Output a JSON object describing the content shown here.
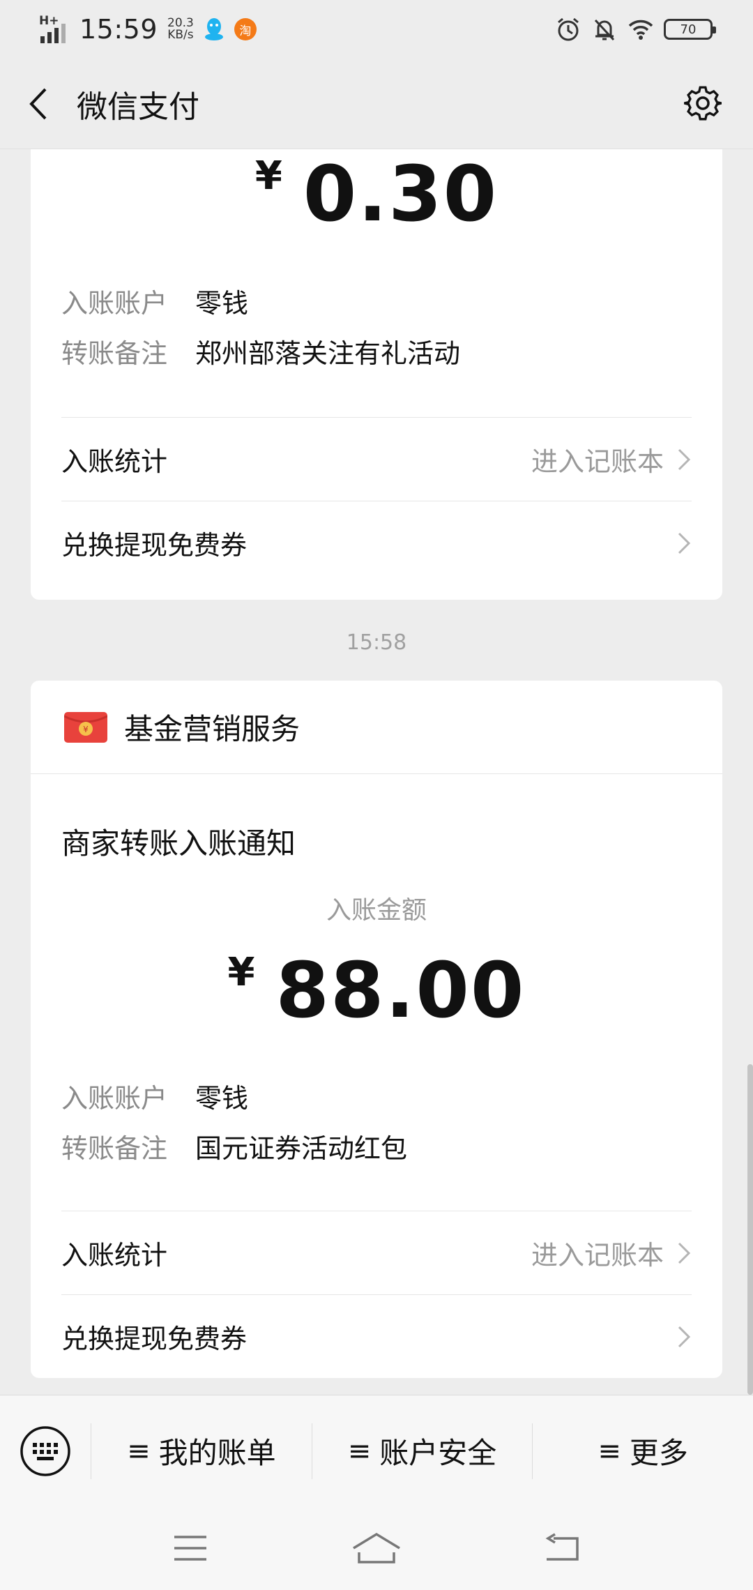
{
  "status_bar": {
    "network": "H+",
    "time": "15:59",
    "speed_value": "20.3",
    "speed_unit": "KB/s",
    "taobao_label": "淘",
    "battery": "70"
  },
  "nav": {
    "title": "微信支付"
  },
  "messages": [
    {
      "amount_currency": "¥",
      "amount_value": "0.30",
      "fields": [
        {
          "label": "入账账户",
          "value": "零钱"
        },
        {
          "label": "转账备注",
          "value": "郑州部落关注有礼活动"
        }
      ],
      "rows": [
        {
          "label": "入账统计",
          "action": "进入记账本"
        },
        {
          "label": "兑换提现免费券",
          "action": ""
        }
      ]
    },
    {
      "timestamp": "15:58",
      "sender": "基金营销服务",
      "title": "商家转账入账通知",
      "amount_label": "入账金额",
      "amount_currency": "¥",
      "amount_value": "88.00",
      "fields": [
        {
          "label": "入账账户",
          "value": "零钱"
        },
        {
          "label": "转账备注",
          "value": "国元证券活动红包"
        }
      ],
      "rows": [
        {
          "label": "入账统计",
          "action": "进入记账本"
        },
        {
          "label": "兑换提现免费券",
          "action": ""
        }
      ]
    }
  ],
  "bottom_menu": {
    "items": [
      {
        "icon": "≡",
        "label": "我的账单"
      },
      {
        "icon": "≡",
        "label": "账户安全"
      },
      {
        "icon": "≡",
        "label": "更多"
      }
    ]
  },
  "colors": {
    "background": "#ededed",
    "card": "#ffffff",
    "muted_text": "#8a8a8a",
    "red_packet": "#e8423c"
  }
}
